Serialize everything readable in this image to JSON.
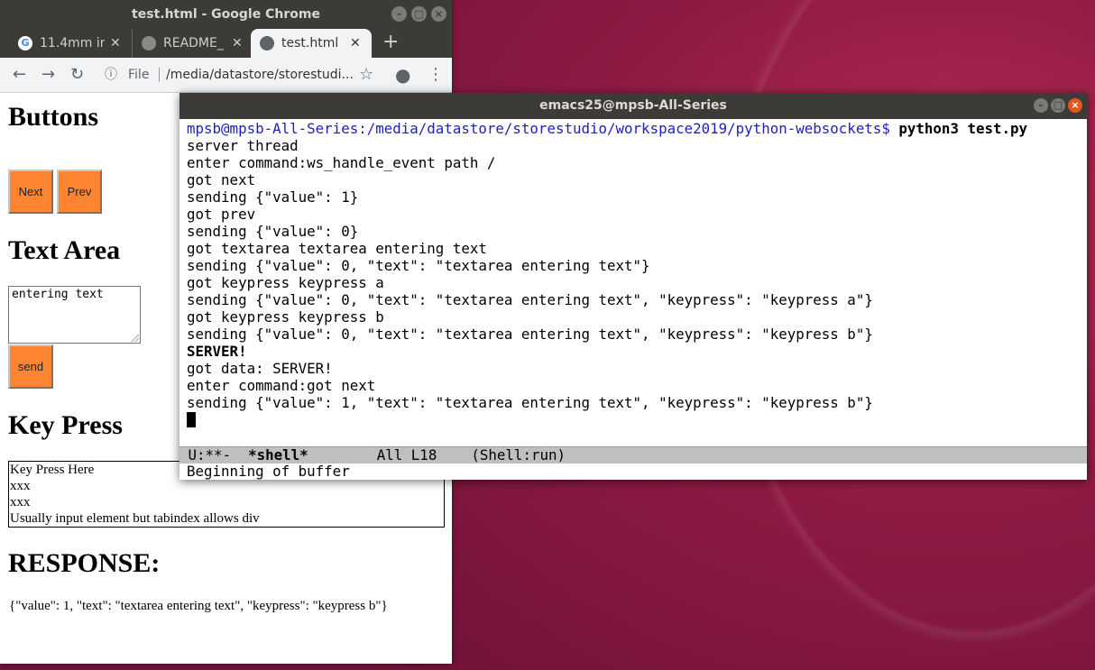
{
  "chrome": {
    "title": "test.html - Google Chrome",
    "tabs": [
      {
        "label": "11.4mm in",
        "favicon": "G"
      },
      {
        "label": "README_",
        "favicon": ""
      },
      {
        "label": "test.html",
        "favicon": ""
      }
    ],
    "close_glyph": "✕",
    "new_tab": "+",
    "address": {
      "scheme_label": "File",
      "url": "/media/datastore/storestudi..."
    }
  },
  "page": {
    "buttons_heading": "Buttons",
    "next_label": "Next",
    "prev_label": "Prev",
    "textarea_heading": "Text Area",
    "textarea_value": "entering text",
    "send_label": "send",
    "keypress_heading": "Key Press",
    "keypress_lines": [
      "Key Press Here",
      "xxx",
      "xxx",
      "Usually input element but tabindex allows div"
    ],
    "response_heading": "RESPONSE:",
    "response_text": "{\"value\": 1, \"text\": \"textarea entering text\", \"keypress\": \"keypress b\"}"
  },
  "emacs": {
    "title": "emacs25@mpsb-All-Series",
    "prompt": "mpsb@mpsb-All-Series:/media/datastore/storestudio/workspace2019/python-websockets$ ",
    "command": "python3 test.py",
    "lines": [
      "server thread",
      "enter command:ws_handle_event path /",
      "got next",
      "sending {\"value\": 1}",
      "got prev",
      "sending {\"value\": 0}",
      "got textarea textarea entering text",
      "sending {\"value\": 0, \"text\": \"textarea entering text\"}",
      "got keypress keypress a",
      "sending {\"value\": 0, \"text\": \"textarea entering text\", \"keypress\": \"keypress a\"}",
      "got keypress keypress b",
      "sending {\"value\": 0, \"text\": \"textarea entering text\", \"keypress\": \"keypress b\"}"
    ],
    "bold_line": "SERVER!",
    "lines_after": [
      "got data: SERVER!",
      "enter command:got next",
      "sending {\"value\": 1, \"text\": \"textarea entering text\", \"keypress\": \"keypress b\"}"
    ],
    "modeline": {
      "state": " U:**-  ",
      "buffer": "*shell*",
      "position": "        All L18    ",
      "mode": "(Shell:run)"
    },
    "minibuffer": "Beginning of buffer"
  },
  "colors": {
    "button_orange": "#ff8533",
    "prompt_blue": "#2020c0",
    "ubuntu_orange": "#e95420"
  }
}
